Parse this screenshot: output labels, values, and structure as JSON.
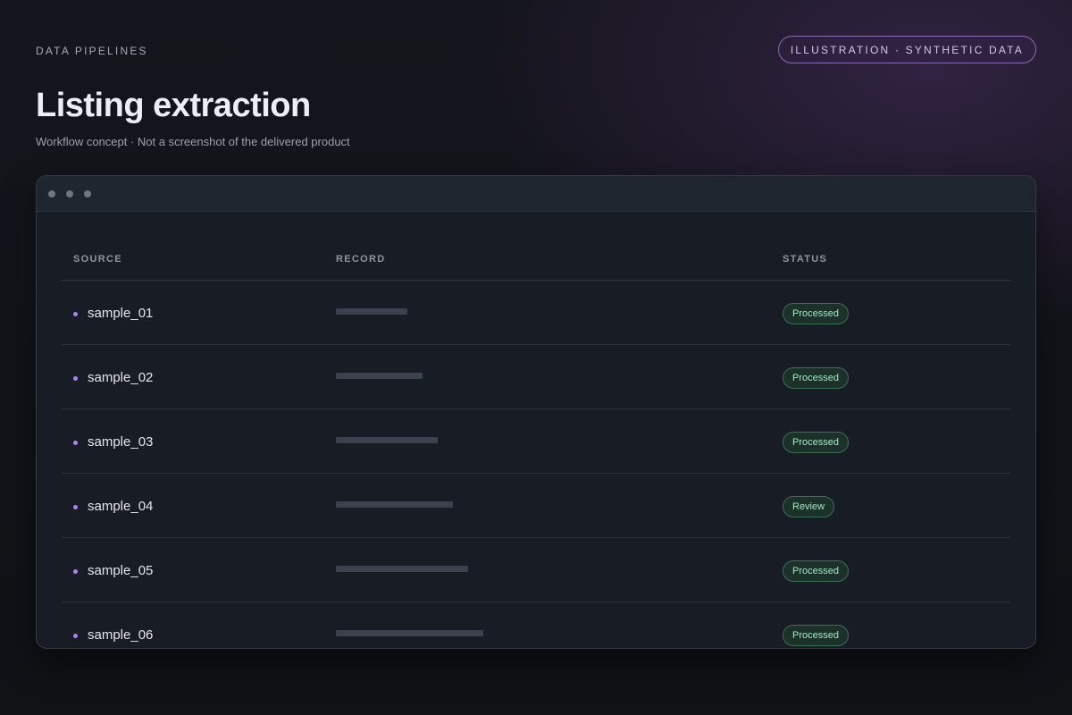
{
  "header": {
    "eyebrow": "DATA PIPELINES",
    "badge": "ILLUSTRATION · SYNTHETIC DATA",
    "title": "Listing extraction",
    "subtitle": "Workflow concept · Not a screenshot of the delivered product"
  },
  "table": {
    "columns": [
      "SOURCE",
      "RECORD",
      "STATUS"
    ],
    "rows": [
      {
        "source": "sample_01",
        "status": "Processed"
      },
      {
        "source": "sample_02",
        "status": "Processed"
      },
      {
        "source": "sample_03",
        "status": "Processed"
      },
      {
        "source": "sample_04",
        "status": "Review"
      },
      {
        "source": "sample_05",
        "status": "Processed"
      },
      {
        "source": "sample_06",
        "status": "Processed"
      }
    ]
  },
  "colors": {
    "accent": "#b084e6",
    "status_bg": "#1c3129",
    "status_text": "#a5e6c4"
  }
}
